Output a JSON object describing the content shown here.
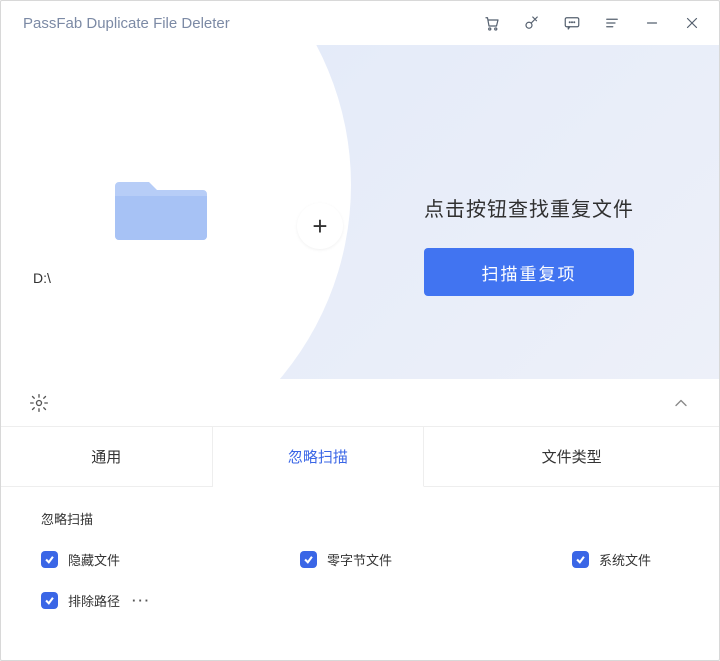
{
  "app": {
    "title": "PassFab Duplicate File Deleter"
  },
  "hero": {
    "drive_label": "D:\\",
    "cta_text": "点击按钮查找重复文件",
    "scan_button": "扫描重复项"
  },
  "tabs": {
    "general": "通用",
    "ignore": "忽略扫描",
    "filetype": "文件类型",
    "active": "ignore"
  },
  "ignore_panel": {
    "section_title": "忽略扫描",
    "items": {
      "hidden": "隐藏文件",
      "zero_byte": "零字节文件",
      "system": "系统文件",
      "exclude_path": "排除路径"
    }
  }
}
